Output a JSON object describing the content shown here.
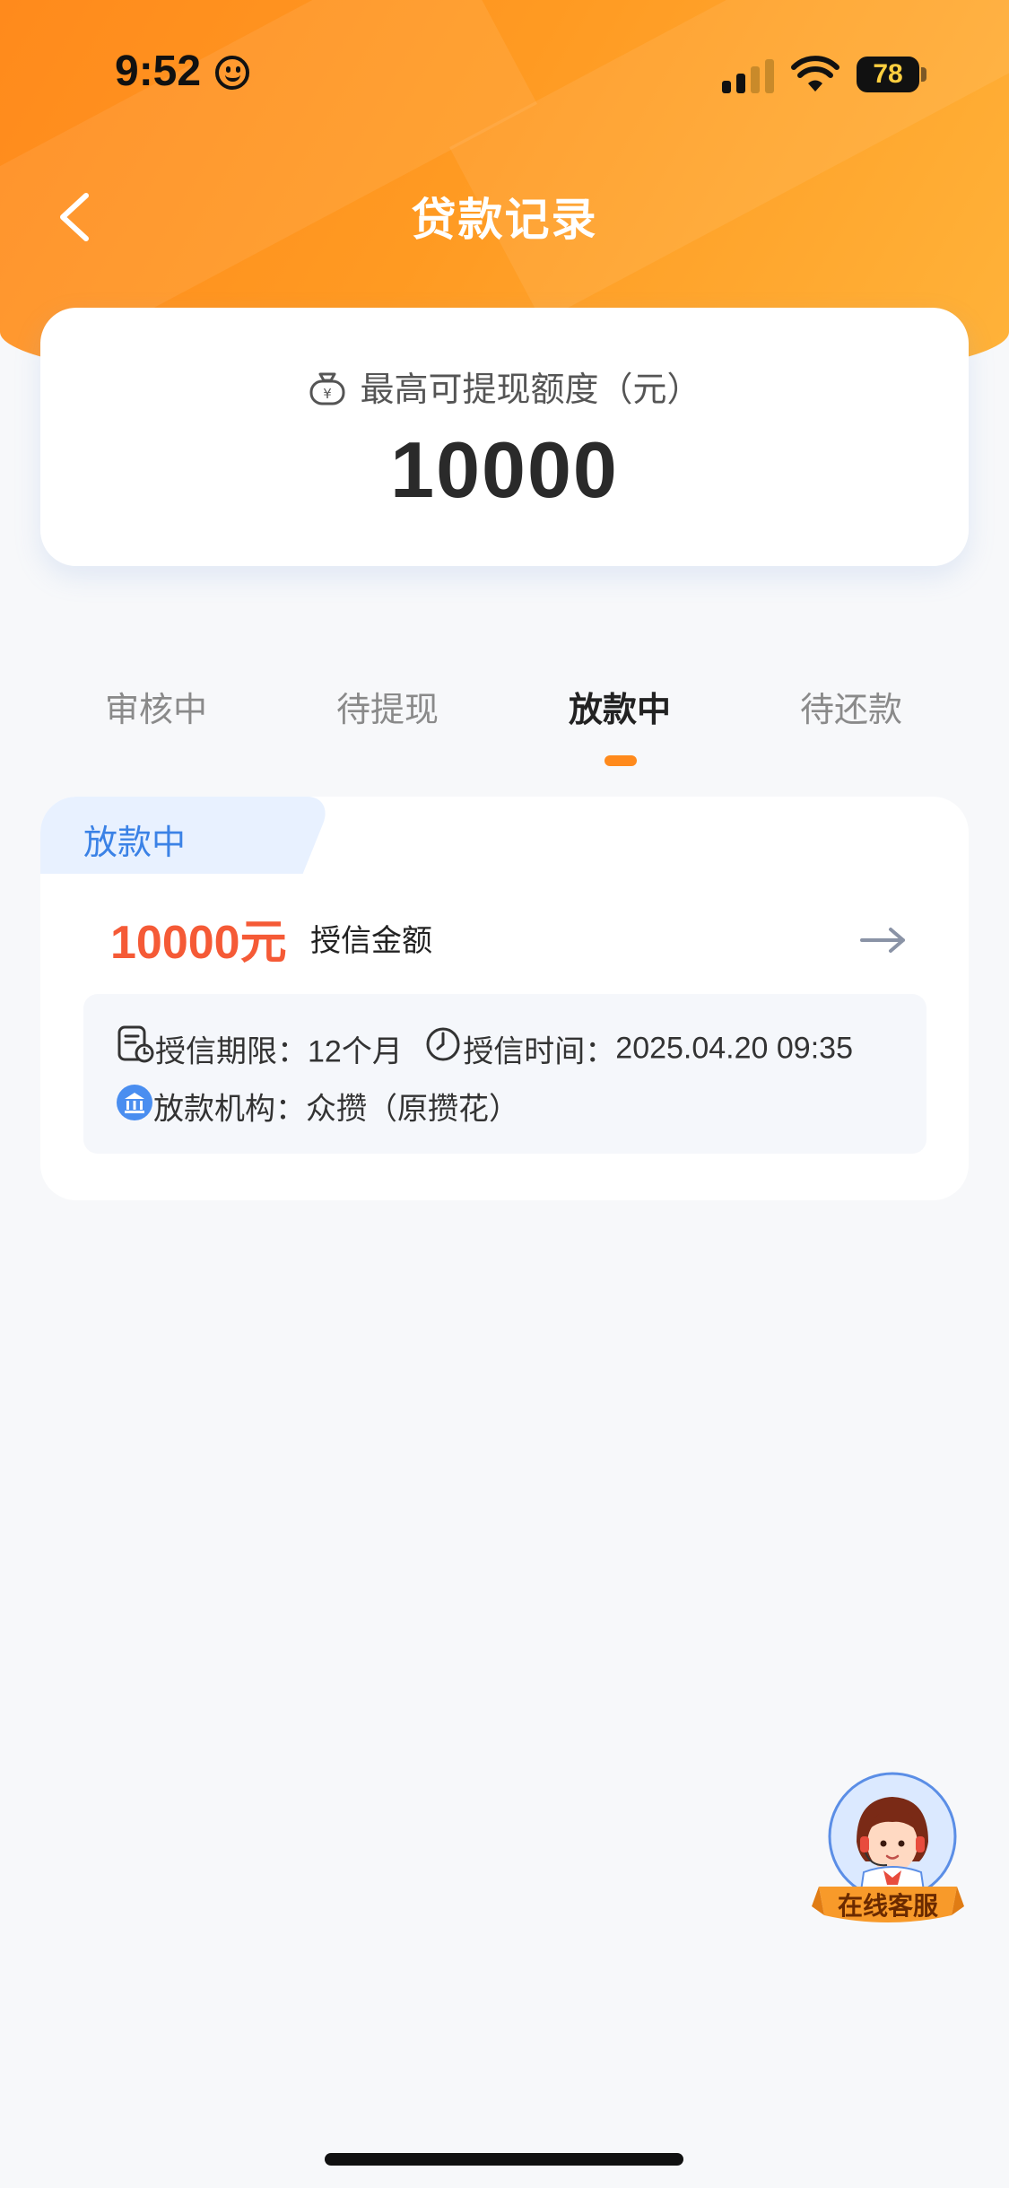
{
  "status_bar": {
    "time": "9:52",
    "battery": "78"
  },
  "header": {
    "title": "贷款记录"
  },
  "quota": {
    "label": "最高可提现额度（元）",
    "value": "10000"
  },
  "tabs": [
    {
      "label": "审核中",
      "active": false
    },
    {
      "label": "待提现",
      "active": false
    },
    {
      "label": "放款中",
      "active": true
    },
    {
      "label": "待还款",
      "active": false
    }
  ],
  "record": {
    "status": "放款中",
    "amount": "10000元",
    "amount_label": "授信金额",
    "term_label": "授信期限：",
    "term_value": "12个月",
    "time_label": "授信时间：",
    "time_value": "2025.04.20 09:35",
    "institution_label": "放款机构：",
    "institution_value": "众攒（原攒花）"
  },
  "customer_service": {
    "label": "在线客服"
  },
  "colors": {
    "brand": "#ff8a1c",
    "amount": "#f55a36",
    "status_tag": "#3b82e6"
  }
}
